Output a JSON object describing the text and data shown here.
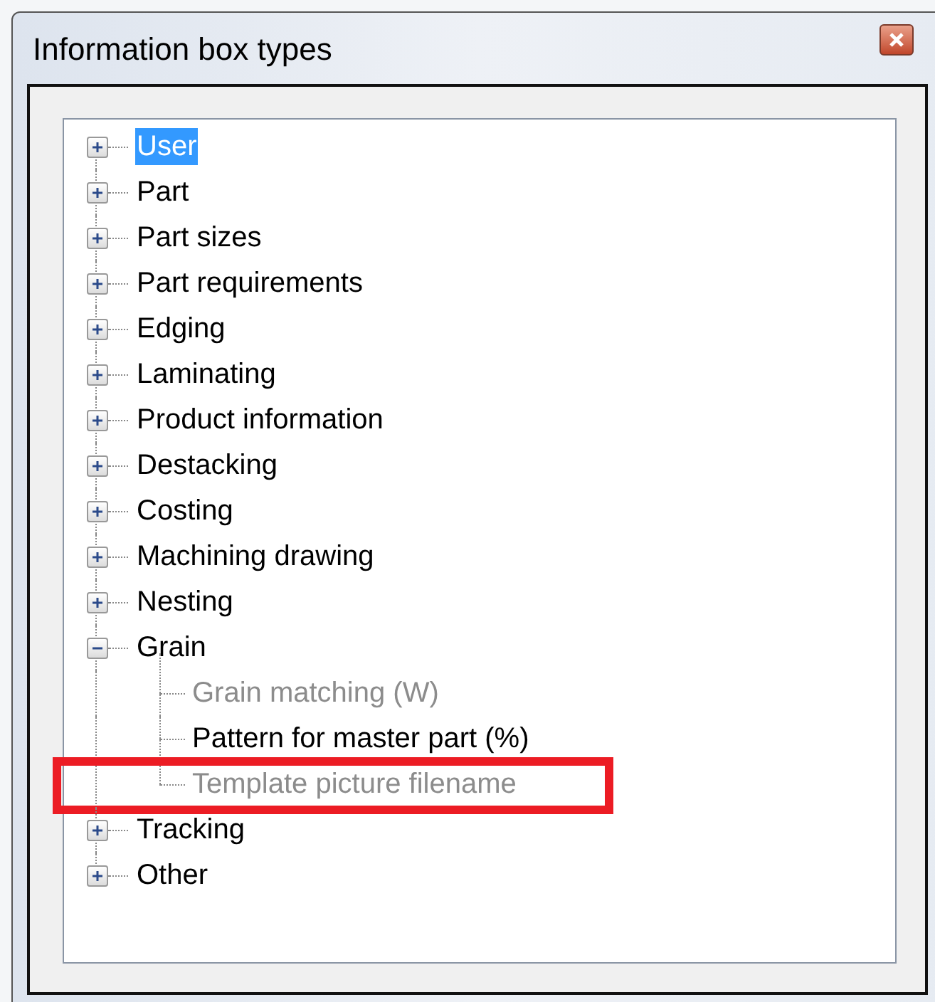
{
  "window": {
    "title": "Information box types"
  },
  "tree": [
    {
      "label": "User",
      "expanded": false,
      "selected": true
    },
    {
      "label": "Part",
      "expanded": false,
      "selected": false
    },
    {
      "label": "Part sizes",
      "expanded": false,
      "selected": false
    },
    {
      "label": "Part requirements",
      "expanded": false,
      "selected": false
    },
    {
      "label": "Edging",
      "expanded": false,
      "selected": false
    },
    {
      "label": "Laminating",
      "expanded": false,
      "selected": false
    },
    {
      "label": "Product information",
      "expanded": false,
      "selected": false
    },
    {
      "label": "Destacking",
      "expanded": false,
      "selected": false
    },
    {
      "label": "Costing",
      "expanded": false,
      "selected": false
    },
    {
      "label": "Machining drawing",
      "expanded": false,
      "selected": false
    },
    {
      "label": "Nesting",
      "expanded": false,
      "selected": false
    },
    {
      "label": "Grain",
      "expanded": true,
      "selected": false,
      "children": [
        {
          "label": "Grain matching (W)",
          "disabled": true,
          "selected": false,
          "highlighted": false
        },
        {
          "label": "Pattern for master part (%)",
          "disabled": false,
          "selected": false,
          "highlighted": false
        },
        {
          "label": "Template picture filename",
          "disabled": true,
          "selected": false,
          "highlighted": true
        }
      ]
    },
    {
      "label": "Tracking",
      "expanded": false,
      "selected": false
    },
    {
      "label": "Other",
      "expanded": false,
      "selected": false
    }
  ]
}
